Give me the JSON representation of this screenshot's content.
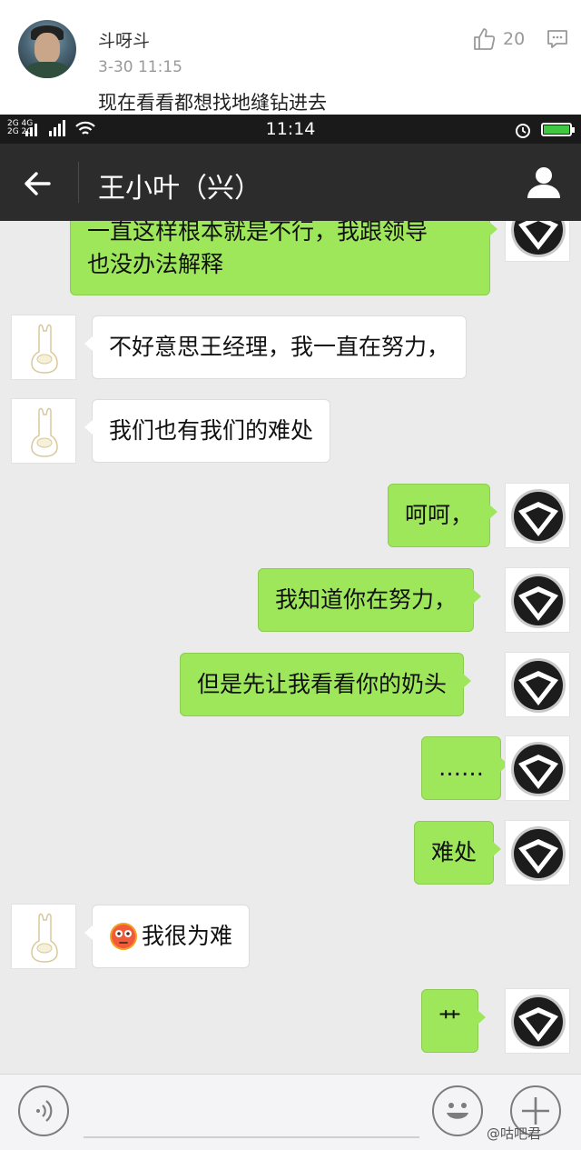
{
  "comment": {
    "username": "斗呀斗",
    "time": "3-30 11:15",
    "text": "现在看看都想找地缝钻进去",
    "likes": "20"
  },
  "statusbar": {
    "time": "11:14",
    "network_top": "2G 4G",
    "network_bottom": "2G 2G"
  },
  "chat": {
    "title": "王小叶（兴）",
    "messages": [
      {
        "from": "me",
        "lines": [
          "一直这样根本就是不行，我跟领导",
          "也没办法解释"
        ]
      },
      {
        "from": "other",
        "lines": [
          "不好意思王经理，我一直在努力，"
        ]
      },
      {
        "from": "other",
        "lines": [
          "我们也有我们的难处"
        ]
      },
      {
        "from": "me",
        "lines": [
          "呵呵，"
        ]
      },
      {
        "from": "me",
        "lines": [
          "我知道你在努力，"
        ]
      },
      {
        "from": "me",
        "lines": [
          "但是先让我看看你的奶头"
        ]
      },
      {
        "from": "me",
        "lines": [
          "……"
        ]
      },
      {
        "from": "me",
        "lines": [
          "难处"
        ]
      },
      {
        "from": "other",
        "lines": [
          "我很为难"
        ],
        "emoji": "flushed-face"
      },
      {
        "from": "me",
        "lines": [
          "艹"
        ]
      }
    ]
  },
  "watermark": "@咕吧君"
}
